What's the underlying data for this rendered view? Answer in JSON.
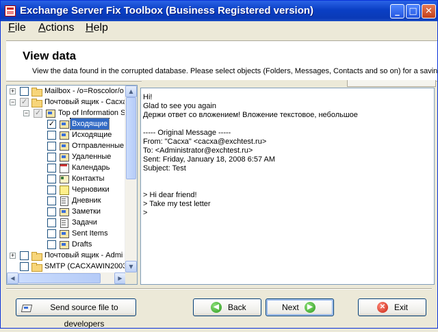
{
  "window": {
    "title": "Exchange Server Fix Toolbox (Business Registered version)",
    "controls": {
      "minimize": "_",
      "maximize": "□",
      "close": "✕"
    }
  },
  "menu": [
    {
      "label": "File",
      "accel": "F",
      "rest": "ile"
    },
    {
      "label": "Actions",
      "accel": "A",
      "rest": "ctions"
    },
    {
      "label": "Help",
      "accel": "H",
      "rest": "elp"
    }
  ],
  "header": {
    "title": "View data",
    "description": "View the data found in the corrupted database. Please select objects (Folders, Messages, Contacts and so on) for a savin"
  },
  "tree": {
    "nodes": [
      {
        "label": "Mailbox - /o=Roscolor/o",
        "icon": "folder-icon",
        "expander": "+",
        "checked": ""
      },
      {
        "label": "Почтовый ящик - Сасха",
        "icon": "folder-icon",
        "expander": "−",
        "checked": "✓"
      },
      {
        "label": "Top of Information S",
        "icon": "mailbox-icon",
        "expander": "−",
        "checked": "✓"
      },
      {
        "label": "Входящие",
        "icon": "inbox-icon",
        "checked": "✓",
        "selected": true
      },
      {
        "label": "Исходящие",
        "icon": "inbox-icon",
        "checked": ""
      },
      {
        "label": "Отправленные",
        "icon": "inbox-icon",
        "checked": ""
      },
      {
        "label": "Удаленные",
        "icon": "inbox-icon",
        "checked": ""
      },
      {
        "label": "Календарь",
        "icon": "calendar-icon",
        "checked": ""
      },
      {
        "label": "Контакты",
        "icon": "contacts-icon",
        "checked": ""
      },
      {
        "label": "Черновики",
        "icon": "notes-icon",
        "checked": ""
      },
      {
        "label": "Дневник",
        "icon": "journal-icon",
        "checked": ""
      },
      {
        "label": "Заметки",
        "icon": "inbox-icon",
        "checked": ""
      },
      {
        "label": "Задачи",
        "icon": "tasks-icon",
        "checked": ""
      },
      {
        "label": "Sent Items",
        "icon": "inbox-icon",
        "checked": ""
      },
      {
        "label": "Drafts",
        "icon": "inbox-icon",
        "checked": ""
      },
      {
        "label": "Почтовый ящик - Admi",
        "icon": "folder-icon",
        "expander": "+",
        "checked": ""
      },
      {
        "label": "SMTP (CACXAWIN2003-",
        "icon": "folder-icon",
        "checked": ""
      }
    ]
  },
  "message": {
    "lines": [
      "Hi!",
      "Glad to see you again",
      "Держи ответ со вложением! Вложение текстовое, небольшое",
      "",
      "----- Original Message -----",
      "From: \"Сасха\" <сасха@exchtest.ru>",
      "To: <Administrator@exchtest.ru>",
      "Sent: Friday, January 18, 2008 6:57 AM",
      "Subject: Test",
      "",
      "",
      "> Hi dear friend!",
      "> Take my test letter",
      ">"
    ]
  },
  "buttons": {
    "send": "Send source file to developers",
    "back": "Back",
    "next": "Next",
    "exit": "Exit"
  }
}
